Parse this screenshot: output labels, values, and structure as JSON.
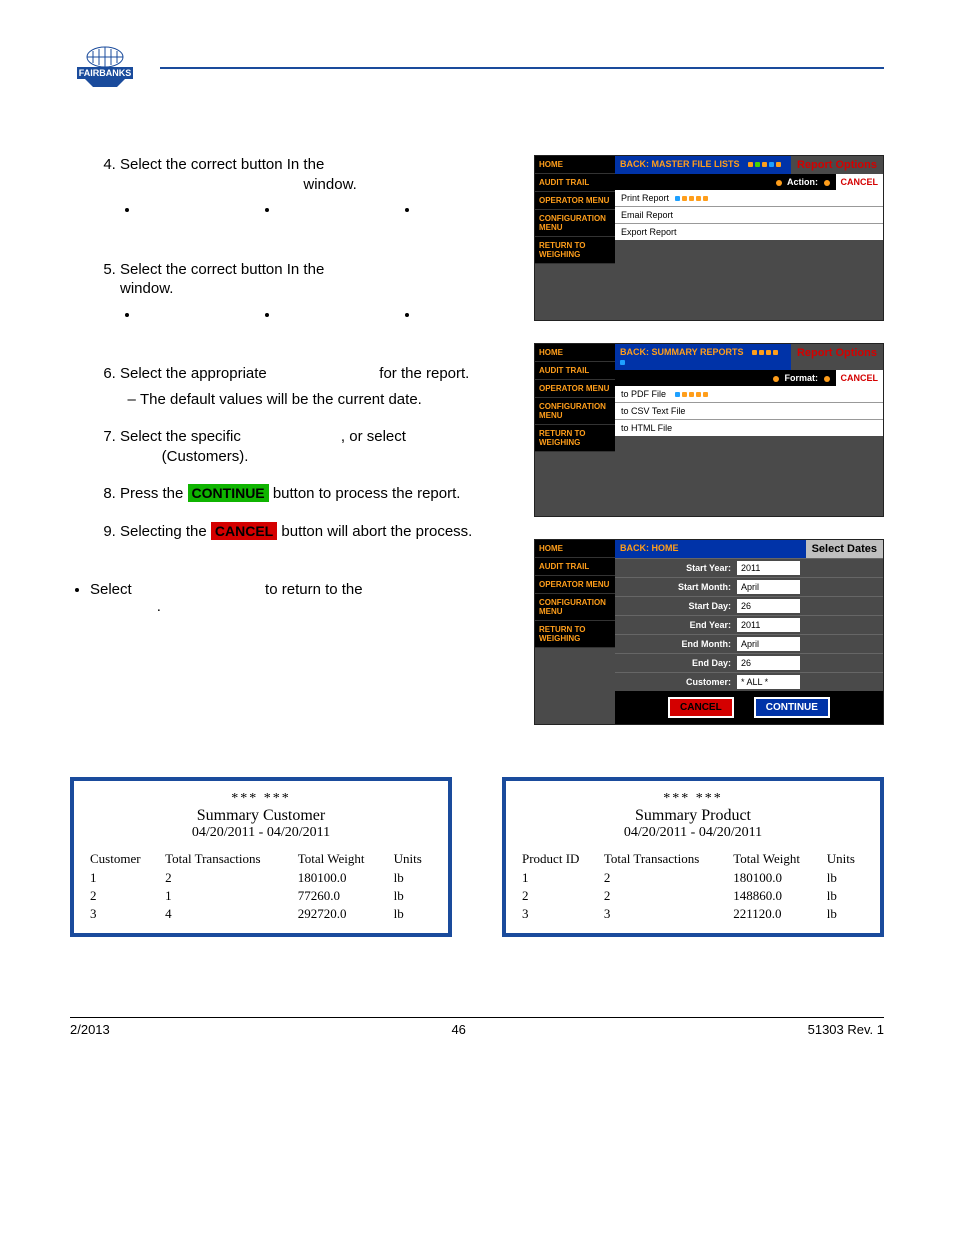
{
  "header": {
    "logo_text": "FAIRBANKS"
  },
  "steps": {
    "s4": {
      "num": "4.",
      "text_a": "Select the correct button In the ",
      "text_b": " window.",
      "blank": "                "
    },
    "s5": {
      "num": "5.",
      "text_a": "Select the correct button In the ",
      "text_b": " window.",
      "blank": "                "
    },
    "s6": {
      "num": "6.",
      "text_a": "Select the appropriate ",
      "text_b": " for the report.",
      "dash": "The default values will be the current date."
    },
    "s7": {
      "num": "7.",
      "text_a": "Select the specific ",
      "text_b": ", or select ",
      "text_c": " (Customers)."
    },
    "s8": {
      "num": "8.",
      "text_a": "Press the ",
      "btn": "CONTINUE",
      "text_b": " button to process the report."
    },
    "s9": {
      "num": "9.",
      "text_a": "Selecting the ",
      "btn": "CANCEL",
      "text_b": " button will abort the process."
    },
    "ret": {
      "text_a": "Select ",
      "text_b": " to return to the ",
      "text_c": "."
    }
  },
  "screen1": {
    "sidebar": [
      "HOME",
      "AUDIT TRAIL",
      "OPERATOR MENU",
      "CONFIGURATION MENU",
      "RETURN TO WEIGHING"
    ],
    "back": "BACK: MASTER FILE LISTS",
    "title": "Report Options",
    "actionlabel": "Action:",
    "cancel": "CANCEL",
    "rows": [
      "Print Report",
      "Email Report",
      "Export Report"
    ]
  },
  "screen2": {
    "sidebar": [
      "HOME",
      "AUDIT TRAIL",
      "OPERATOR MENU",
      "CONFIGURATION MENU",
      "RETURN TO WEIGHING"
    ],
    "back": "BACK: SUMMARY REPORTS",
    "title": "Report Options",
    "actionlabel": "Format:",
    "cancel": "CANCEL",
    "rows": [
      "to PDF File",
      "to CSV Text File",
      "to HTML File"
    ]
  },
  "screen3": {
    "sidebar": [
      "HOME",
      "AUDIT TRAIL",
      "OPERATOR MENU",
      "CONFIGURATION MENU",
      "RETURN TO WEIGHING"
    ],
    "back": "BACK: HOME",
    "title": "Select Dates",
    "fields": [
      {
        "label": "Start Year:",
        "value": "2011"
      },
      {
        "label": "Start Month:",
        "value": "April"
      },
      {
        "label": "Start Day:",
        "value": "26"
      },
      {
        "label": "End Year:",
        "value": "2011"
      },
      {
        "label": "End Month:",
        "value": "April"
      },
      {
        "label": "End Day:",
        "value": "26"
      },
      {
        "label": "Customer:",
        "value": "* ALL *"
      }
    ],
    "cancel": "CANCEL",
    "cont": "CONTINUE"
  },
  "reportA": {
    "stars": "***  ***",
    "name": "Summary Customer",
    "dates": "04/20/2011 - 04/20/2011",
    "headers": [
      "Customer",
      "Total Transactions",
      "Total Weight",
      "Units"
    ],
    "rows": [
      [
        "1",
        "2",
        "180100.0",
        "lb"
      ],
      [
        "2",
        "1",
        "77260.0",
        "lb"
      ],
      [
        "3",
        "4",
        "292720.0",
        "lb"
      ]
    ]
  },
  "reportB": {
    "stars": "***  ***",
    "name": "Summary Product",
    "dates": "04/20/2011 - 04/20/2011",
    "headers": [
      "Product ID",
      "Total Transactions",
      "Total Weight",
      "Units"
    ],
    "rows": [
      [
        "1",
        "2",
        "180100.0",
        "lb"
      ],
      [
        "2",
        "2",
        "148860.0",
        "lb"
      ],
      [
        "3",
        "3",
        "221120.0",
        "lb"
      ]
    ]
  },
  "footer": {
    "left": "2/2013",
    "center": "46",
    "right": "51303    Rev. 1"
  }
}
